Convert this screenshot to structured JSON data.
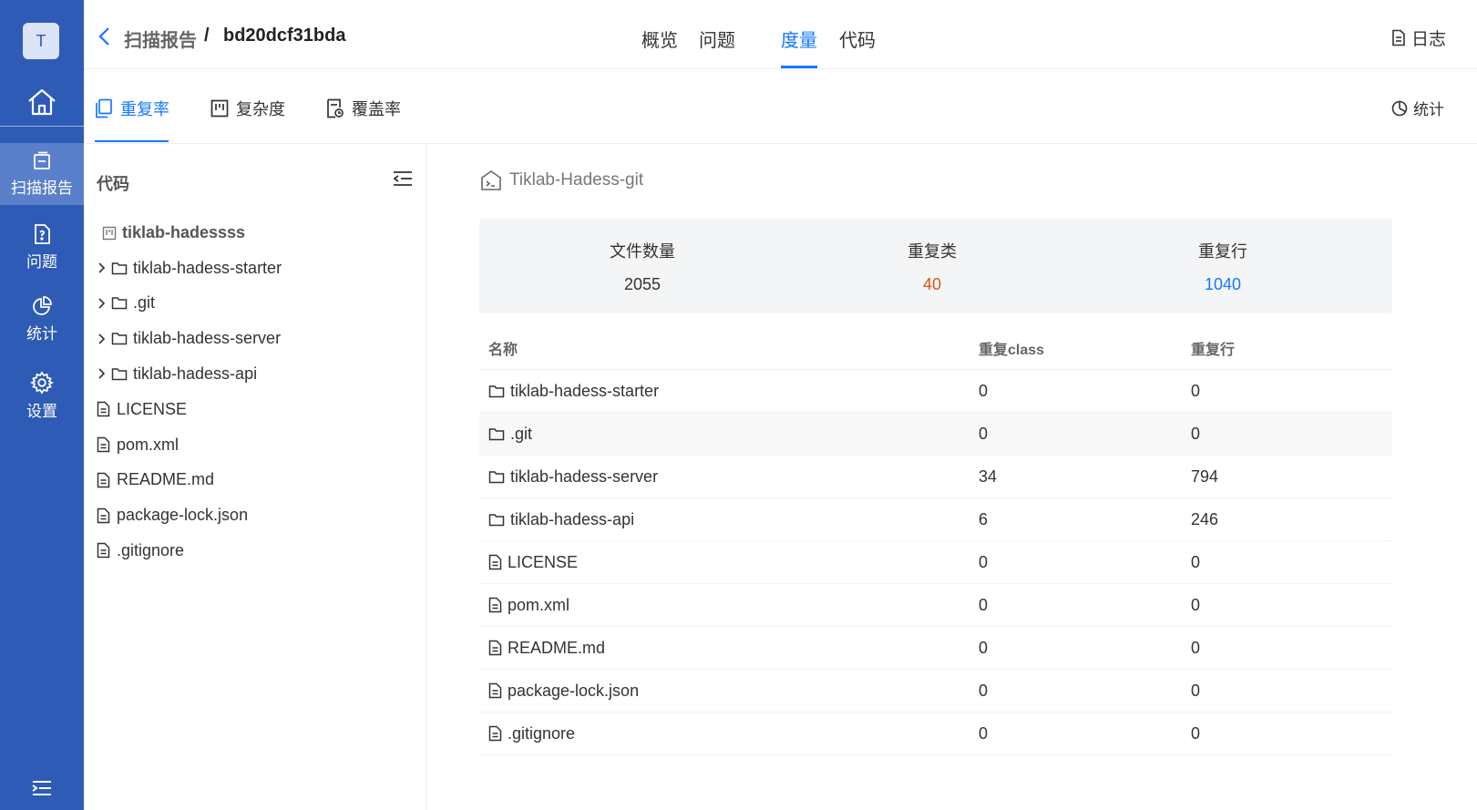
{
  "sidebar": {
    "avatar": "T",
    "items": [
      {
        "label": "扫描报告",
        "icon": "report-icon",
        "active": true
      },
      {
        "label": "问题",
        "icon": "question-doc-icon",
        "active": false
      },
      {
        "label": "统计",
        "icon": "pie-chart-icon",
        "active": false
      },
      {
        "label": "设置",
        "icon": "gear-icon",
        "active": false
      }
    ]
  },
  "header": {
    "breadcrumb_parent": "扫描报告",
    "breadcrumb_sep": "/",
    "breadcrumb_current": "bd20dcf31bda",
    "tabs": [
      "概览",
      "问题",
      "度量",
      "代码"
    ],
    "active_tab": "度量",
    "log_label": "日志"
  },
  "subtabs": {
    "items": [
      "重复率",
      "复杂度",
      "覆盖率"
    ],
    "active": "重复率",
    "stat_label": "统计"
  },
  "tree": {
    "title": "代码",
    "repo": "tiklab-hadessss",
    "nodes": [
      {
        "name": "tiklab-hadess-starter",
        "type": "folder"
      },
      {
        "name": ".git",
        "type": "folder"
      },
      {
        "name": "tiklab-hadess-server",
        "type": "folder"
      },
      {
        "name": "tiklab-hadess-api",
        "type": "folder"
      },
      {
        "name": "LICENSE",
        "type": "file"
      },
      {
        "name": "pom.xml",
        "type": "file"
      },
      {
        "name": "README.md",
        "type": "file"
      },
      {
        "name": "package-lock.json",
        "type": "file"
      },
      {
        "name": ".gitignore",
        "type": "file"
      }
    ]
  },
  "main": {
    "repo_title": "Tiklab-Hadess-git",
    "summary": [
      {
        "label": "文件数量",
        "value": "2055",
        "color": "#333333"
      },
      {
        "label": "重复类",
        "value": "40",
        "color": "#d4590f"
      },
      {
        "label": "重复行",
        "value": "1040",
        "color": "#1677ff"
      }
    ],
    "table": {
      "headers": [
        "名称",
        "重复class",
        "重复行"
      ],
      "rows": [
        {
          "name": "tiklab-hadess-starter",
          "type": "folder",
          "dup_class": "0",
          "dup_lines": "0"
        },
        {
          "name": ".git",
          "type": "folder",
          "dup_class": "0",
          "dup_lines": "0"
        },
        {
          "name": "tiklab-hadess-server",
          "type": "folder",
          "dup_class": "34",
          "dup_lines": "794"
        },
        {
          "name": "tiklab-hadess-api",
          "type": "folder",
          "dup_class": "6",
          "dup_lines": "246"
        },
        {
          "name": "LICENSE",
          "type": "file",
          "dup_class": "0",
          "dup_lines": "0"
        },
        {
          "name": "pom.xml",
          "type": "file",
          "dup_class": "0",
          "dup_lines": "0"
        },
        {
          "name": "README.md",
          "type": "file",
          "dup_class": "0",
          "dup_lines": "0"
        },
        {
          "name": "package-lock.json",
          "type": "file",
          "dup_class": "0",
          "dup_lines": "0"
        },
        {
          "name": ".gitignore",
          "type": "file",
          "dup_class": "0",
          "dup_lines": "0"
        }
      ]
    }
  },
  "colors": {
    "sidebar": "#2e5bb5",
    "accent": "#1677ff"
  }
}
